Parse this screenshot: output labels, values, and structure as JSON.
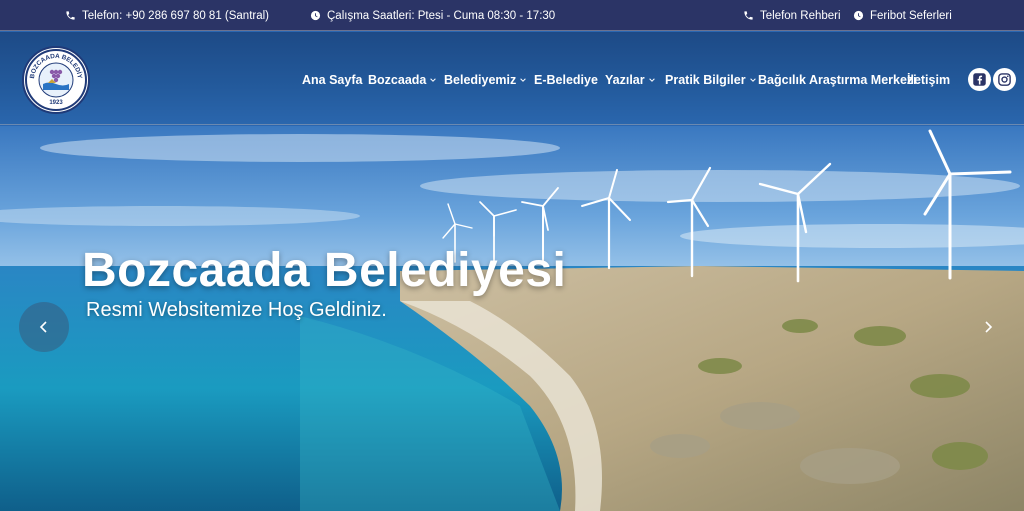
{
  "topbar": {
    "phone": "Telefon: +90 286 697 80 81 (Santral)",
    "hours": "Çalışma Saatleri: Ptesi - Cuma 08:30 - 17:30",
    "directory": "Telefon Rehberi",
    "ferry": "Feribot Seferleri"
  },
  "logo": {
    "top_text": "BOZCAADA BELEDİYESİ",
    "year": "1923"
  },
  "nav": {
    "items": [
      {
        "label": "Ana Sayfa",
        "dropdown": false
      },
      {
        "label": "Bozcaada",
        "dropdown": true
      },
      {
        "label": "Belediyemiz",
        "dropdown": true
      },
      {
        "label": "E-Belediye",
        "dropdown": false
      },
      {
        "label": "Yazılar",
        "dropdown": true
      },
      {
        "label": "Pratik Bilgiler",
        "dropdown": true
      },
      {
        "label": "Bağcılık Araştırma Merkezi",
        "dropdown": false
      },
      {
        "label": "İletişim",
        "dropdown": false
      }
    ],
    "social": [
      "facebook-icon",
      "instagram-icon"
    ]
  },
  "hero": {
    "title": "Bozcaada Belediyesi",
    "subtitle": "Resmi Websitemize Hoş Geldiniz."
  },
  "colors": {
    "topbar": "#2b3466",
    "header": "#235a9c",
    "sea": "#1f7fb8",
    "sky": "#4f8fd0"
  }
}
